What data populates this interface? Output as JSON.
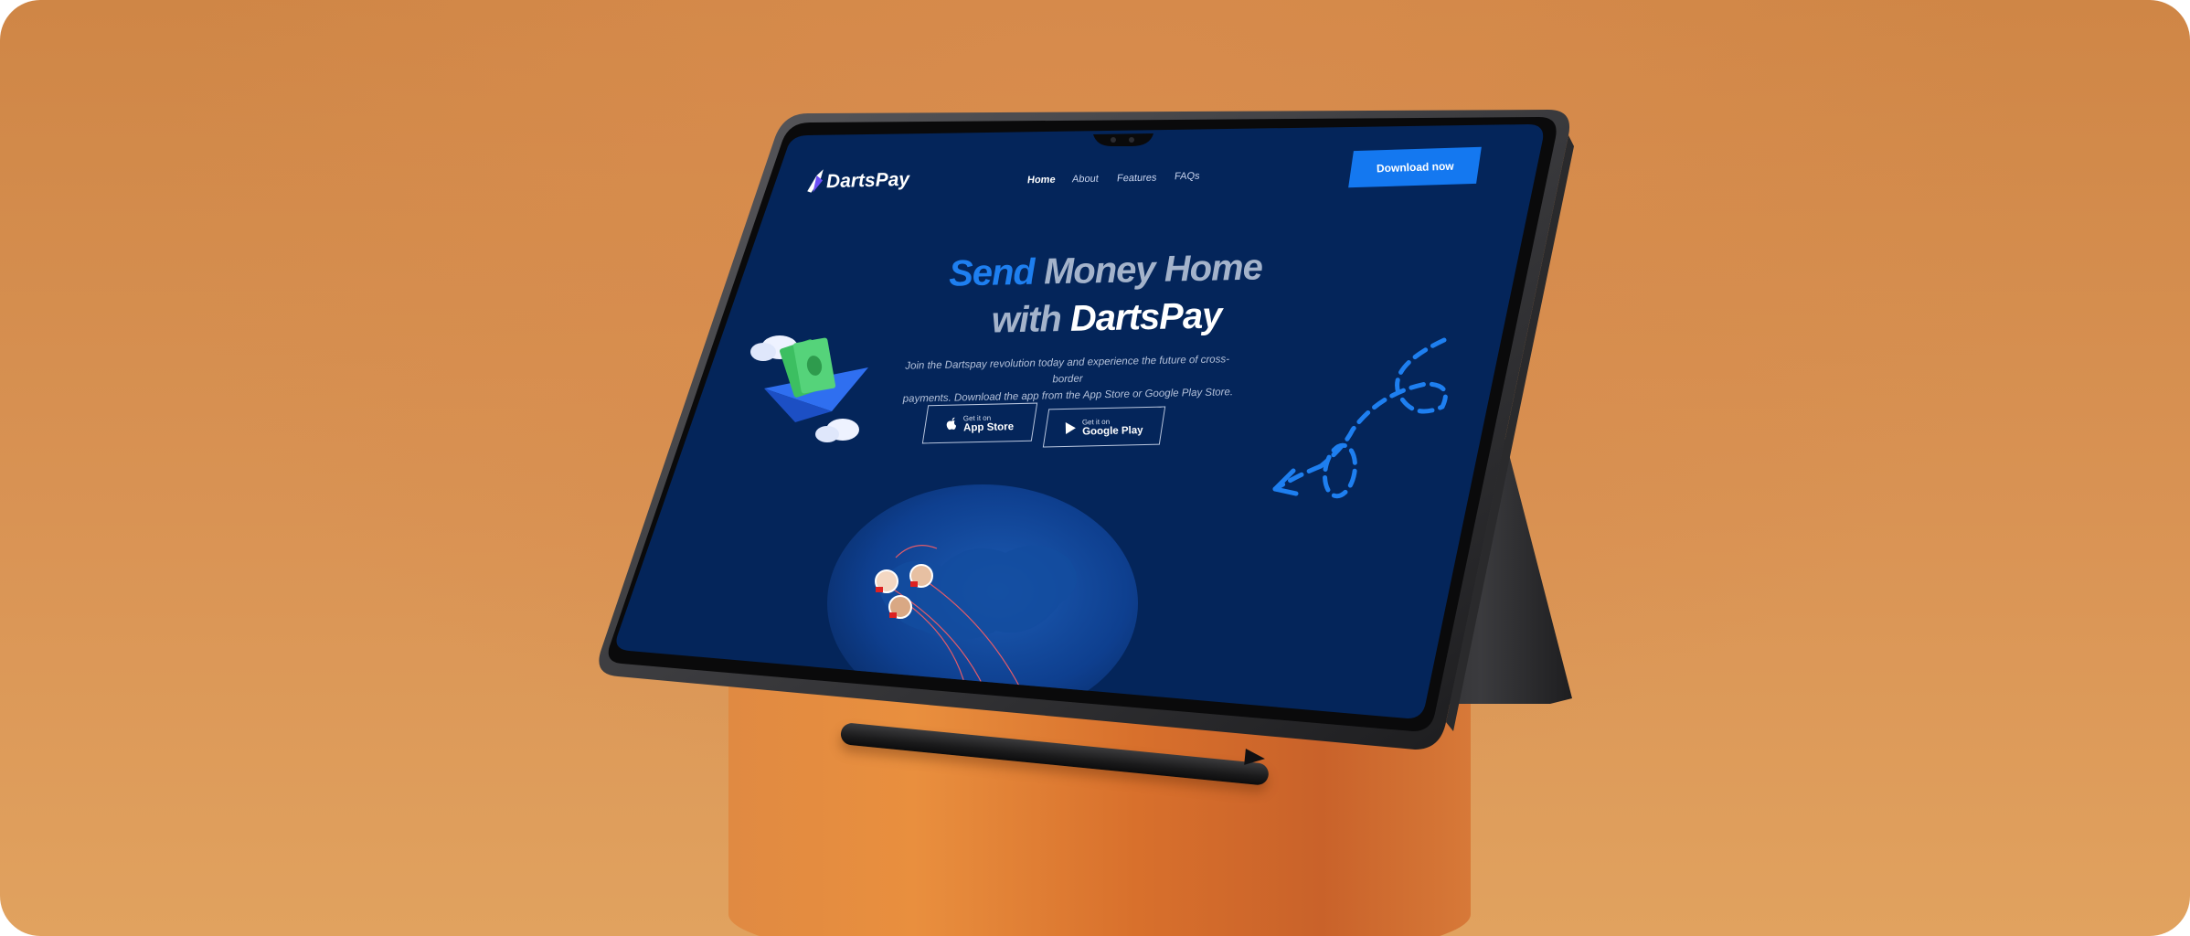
{
  "brand": {
    "name": "DartsPay"
  },
  "nav": {
    "items": [
      {
        "label": "Home",
        "active": true
      },
      {
        "label": "About",
        "active": false
      },
      {
        "label": "Features",
        "active": false
      },
      {
        "label": "FAQs",
        "active": false
      }
    ],
    "cta_label": "Download now"
  },
  "hero": {
    "title_word_1": "Send",
    "title_word_2": "Money Home",
    "title_word_3": "with",
    "title_word_4": "DartsPay",
    "subtitle_line_1": "Join the Dartspay revolution today and experience the future of cross-border",
    "subtitle_line_2": "payments. Download the app from the App Store or Google Play Store."
  },
  "stores": {
    "apple": {
      "small": "Get it on",
      "big": "App Store",
      "icon": "apple-icon"
    },
    "google": {
      "small": "Get it on",
      "big": "Google Play",
      "icon": "play-icon"
    }
  },
  "colors": {
    "background": "#d58a4b",
    "screen": "#04255a",
    "accent": "#1478f0",
    "podium": "#e38d47"
  }
}
